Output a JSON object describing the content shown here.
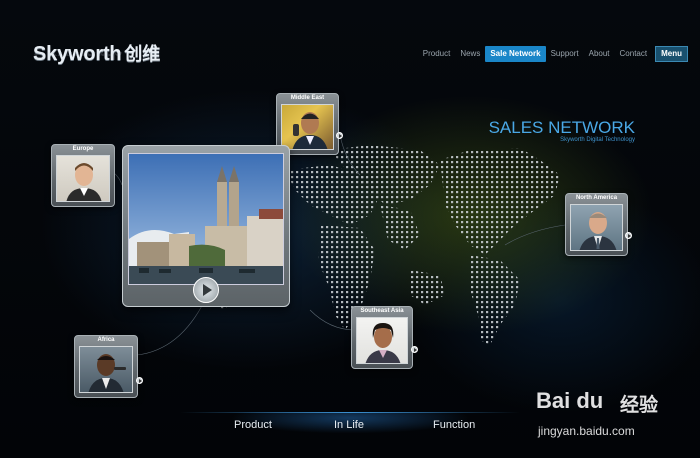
{
  "brand": {
    "name": "Skyworth",
    "name_cn": "创维"
  },
  "nav": {
    "items": [
      {
        "label": "Product"
      },
      {
        "label": "News"
      },
      {
        "label": "Sale Network"
      },
      {
        "label": "Support"
      },
      {
        "label": "About"
      },
      {
        "label": "Contact"
      }
    ],
    "active": "Sale Network",
    "menu_label": "Menu"
  },
  "hero": {
    "title": "SALES NETWORK",
    "subtitle": "Skyworth Digital Technology"
  },
  "regions": {
    "middle_east": {
      "label": "Middle East"
    },
    "europe": {
      "label": "Europe"
    },
    "north_america": {
      "label": "North America"
    },
    "southeast_asia": {
      "label": "Southeast Asia"
    },
    "africa": {
      "label": "Africa"
    }
  },
  "bottom_nav": {
    "items": [
      {
        "label": "Product"
      },
      {
        "label": "In Life"
      },
      {
        "label": "Function"
      }
    ]
  },
  "watermark": {
    "brand": "Bai du",
    "text": "经验",
    "url": "jingyan.baidu.com"
  },
  "colors": {
    "accent": "#1a86c8",
    "title": "#4aa8e6",
    "background": "#03060a"
  }
}
